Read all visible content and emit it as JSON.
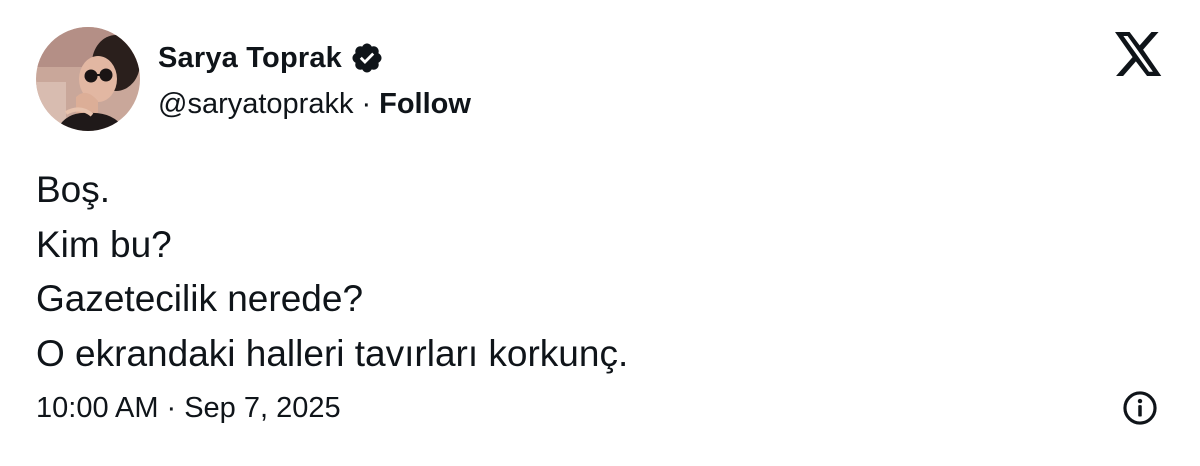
{
  "author": {
    "display_name": "Sarya Toprak",
    "handle": "@saryatoprakk",
    "separator": "·",
    "follow_label": "Follow",
    "verified_icon": "verified-badge-icon",
    "avatar": "avatar-photo"
  },
  "platform_icon": "x-logo-icon",
  "tweet": {
    "lines": [
      "Boş.",
      "Kim bu?",
      "Gazetecilik nerede?",
      "O ekrandaki halleri tavırları korkunç."
    ]
  },
  "meta": {
    "time": "10:00 AM",
    "separator": "·",
    "date": "Sep 7, 2025",
    "info_icon": "info-icon"
  },
  "colors": {
    "text": "#0f1419",
    "background": "#ffffff"
  }
}
